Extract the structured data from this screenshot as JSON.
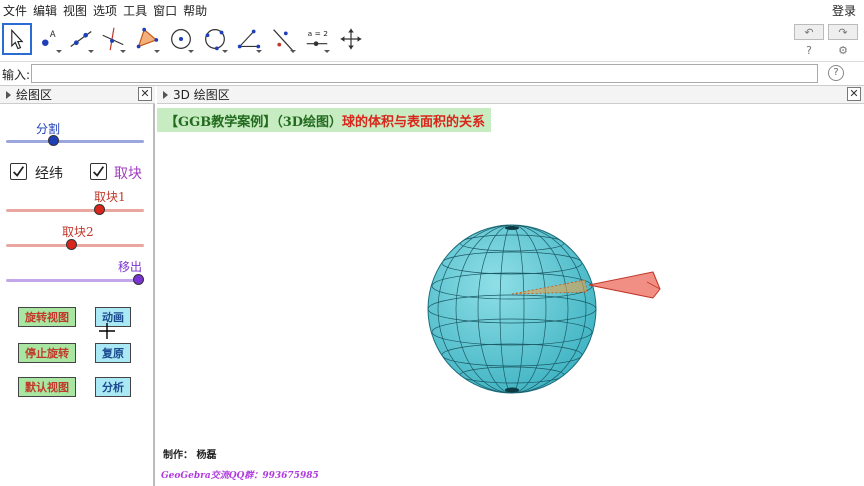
{
  "menu": {
    "items": [
      "文件",
      "编辑",
      "视图",
      "选项",
      "工具",
      "窗口",
      "帮助"
    ],
    "login": "登录"
  },
  "toolbar": {
    "tools": [
      "move-tool",
      "point-tool",
      "line-tool",
      "perpendicular-line-tool",
      "polygon-tool",
      "circle-tool",
      "circle-through-points-tool",
      "angle-tool",
      "reflect-tool",
      "slider-tool",
      "move-view-tool"
    ],
    "slider_tool_text": "a = 2",
    "selected": "move-tool"
  },
  "inputbar": {
    "label": "输入:",
    "value": "",
    "placeholder": ""
  },
  "left_panel": {
    "title": "绘图区",
    "sliders": [
      {
        "label": "分割",
        "value": 0.33,
        "color": "#1f3fb8"
      },
      {
        "label": "取块1",
        "value": 0.69,
        "color": "#d9261c"
      },
      {
        "label": "取块2",
        "value": 0.47,
        "color": "#d9261c"
      },
      {
        "label": "移出",
        "value": 1.0,
        "color": "#7b34d2"
      }
    ],
    "checkboxes": [
      {
        "label": "经纬",
        "checked": true
      },
      {
        "label": "取块",
        "checked": true
      }
    ],
    "buttons": {
      "rotate_view": "旋转视图",
      "animate": "动画",
      "stop_rotate": "停止旋转",
      "reset": "复原",
      "default_view": "默认视图",
      "analyze": "分析"
    }
  },
  "right_panel": {
    "title": "3D 绘图区",
    "banner_part1": "【GGB教学案例】（3D绘图）",
    "banner_part2": "球的体积与表面积的关系",
    "credit": "制作：  杨磊",
    "qq": "GeoGebra交流QQ群：993675985"
  },
  "colors": {
    "sphere": "#5cc8d4",
    "wedge": "#e8463a",
    "banner_bg": "#c7ecc1",
    "banner_red": "#d9261c",
    "selection": "#2b6cd4"
  }
}
